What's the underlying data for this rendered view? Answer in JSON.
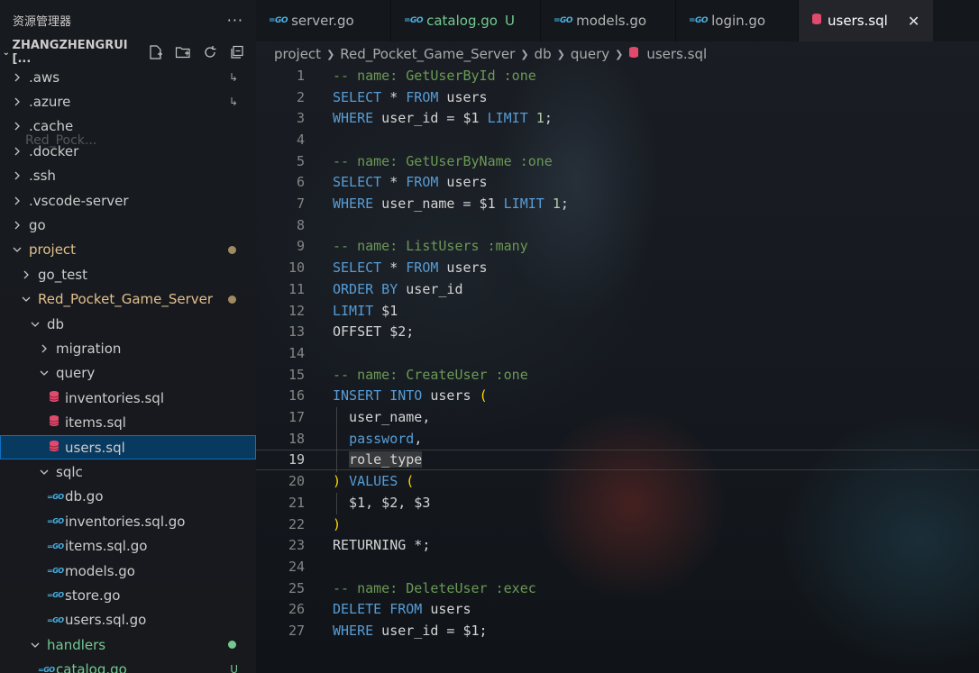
{
  "explorer": {
    "title": "资源管理器",
    "workspace": "ZHANGZHENGRUI [...",
    "items": [
      {
        "label": ".aws",
        "kind": "folder",
        "level": 0,
        "open": false,
        "marker": "↳"
      },
      {
        "label": ".azure",
        "kind": "folder",
        "level": 0,
        "open": false,
        "marker": "↳"
      },
      {
        "label": ".cache",
        "kind": "folder",
        "level": 0,
        "open": false
      },
      {
        "label": ".docker",
        "kind": "folder",
        "level": 0,
        "open": false
      },
      {
        "label": ".ssh",
        "kind": "folder",
        "level": 0,
        "open": false
      },
      {
        "label": ".vscode-server",
        "kind": "folder",
        "level": 0,
        "open": false
      },
      {
        "label": "go",
        "kind": "folder",
        "level": 0,
        "open": false
      },
      {
        "label": "project",
        "kind": "folder",
        "level": 0,
        "open": true,
        "status": "modified"
      },
      {
        "label": "go_test",
        "kind": "folder",
        "level": 1,
        "open": false
      },
      {
        "label": "Red_Pocket_Game_Server",
        "kind": "folder",
        "level": 1,
        "open": true,
        "status": "modified"
      },
      {
        "label": "db",
        "kind": "folder",
        "level": 2,
        "open": true
      },
      {
        "label": "migration",
        "kind": "folder",
        "level": 3,
        "open": false
      },
      {
        "label": "query",
        "kind": "folder",
        "level": 3,
        "open": true
      },
      {
        "label": "inventories.sql",
        "kind": "sql",
        "level": 4
      },
      {
        "label": "items.sql",
        "kind": "sql",
        "level": 4
      },
      {
        "label": "users.sql",
        "kind": "sql",
        "level": 4,
        "selected": true
      },
      {
        "label": "sqlc",
        "kind": "folder",
        "level": 3,
        "open": true
      },
      {
        "label": "db.go",
        "kind": "go",
        "level": 4
      },
      {
        "label": "inventories.sql.go",
        "kind": "go",
        "level": 4
      },
      {
        "label": "items.sql.go",
        "kind": "go",
        "level": 4
      },
      {
        "label": "models.go",
        "kind": "go",
        "level": 4
      },
      {
        "label": "store.go",
        "kind": "go",
        "level": 4
      },
      {
        "label": "users.sql.go",
        "kind": "go",
        "level": 4
      },
      {
        "label": "handlers",
        "kind": "folder",
        "level": 2,
        "open": true,
        "status": "untracked"
      },
      {
        "label": "catalog.go",
        "kind": "go",
        "level": 3,
        "badge": "U"
      }
    ]
  },
  "tabs": [
    {
      "label": "server.go",
      "icon": "go-file-icon"
    },
    {
      "label": "catalog.go",
      "icon": "go-file-icon",
      "badge": "U",
      "modified": true
    },
    {
      "label": "models.go",
      "icon": "go-file-icon"
    },
    {
      "label": "login.go",
      "icon": "go-file-icon"
    },
    {
      "label": "users.sql",
      "icon": "database-icon",
      "active": true
    }
  ],
  "breadcrumb": [
    "project",
    "Red_Pocket_Game_Server",
    "db",
    "query",
    "users.sql"
  ],
  "editor": {
    "current_line": 19,
    "lines": [
      [
        [
          "c",
          "-- name: GetUserById :one"
        ]
      ],
      [
        [
          "k",
          "SELECT"
        ],
        [
          "p",
          " * "
        ],
        [
          "k",
          "FROM"
        ],
        [
          "p",
          " users"
        ]
      ],
      [
        [
          "k",
          "WHERE"
        ],
        [
          "p",
          " user_id = $1 "
        ],
        [
          "k",
          "LIMIT"
        ],
        [
          "p",
          " "
        ],
        [
          "n",
          "1"
        ],
        [
          "p",
          ";"
        ]
      ],
      [],
      [
        [
          "c",
          "-- name: GetUserByName :one"
        ]
      ],
      [
        [
          "k",
          "SELECT"
        ],
        [
          "p",
          " * "
        ],
        [
          "k",
          "FROM"
        ],
        [
          "p",
          " users"
        ]
      ],
      [
        [
          "k",
          "WHERE"
        ],
        [
          "p",
          " user_name = $1 "
        ],
        [
          "k",
          "LIMIT"
        ],
        [
          "p",
          " "
        ],
        [
          "n",
          "1"
        ],
        [
          "p",
          ";"
        ]
      ],
      [],
      [
        [
          "c",
          "-- name: ListUsers :many"
        ]
      ],
      [
        [
          "k",
          "SELECT"
        ],
        [
          "p",
          " * "
        ],
        [
          "k",
          "FROM"
        ],
        [
          "p",
          " users"
        ]
      ],
      [
        [
          "k",
          "ORDER BY"
        ],
        [
          "p",
          " user_id"
        ]
      ],
      [
        [
          "k",
          "LIMIT"
        ],
        [
          "p",
          " $1"
        ]
      ],
      [
        [
          "p",
          "OFFSET $2;"
        ]
      ],
      [],
      [
        [
          "c",
          "-- name: CreateUser :one"
        ]
      ],
      [
        [
          "k",
          "INSERT INTO"
        ],
        [
          "p",
          " users "
        ],
        [
          "y",
          "("
        ]
      ],
      [
        [
          "p",
          "  user_name,"
        ]
      ],
      [
        [
          "p",
          "  "
        ],
        [
          "k",
          "password"
        ],
        [
          "p",
          ","
        ]
      ],
      [
        [
          "p",
          "  "
        ],
        [
          "h",
          "role_type"
        ]
      ],
      [
        [
          "y",
          ")"
        ],
        [
          "p",
          " "
        ],
        [
          "k",
          "VALUES"
        ],
        [
          "p",
          " "
        ],
        [
          "y",
          "("
        ]
      ],
      [
        [
          "p",
          "  $1, $2, $3"
        ]
      ],
      [
        [
          "y",
          ")"
        ]
      ],
      [
        [
          "p",
          "RETURNING *;"
        ]
      ],
      [],
      [
        [
          "c",
          "-- name: DeleteUser :exec"
        ]
      ],
      [
        [
          "k",
          "DELETE FROM"
        ],
        [
          "p",
          " users"
        ]
      ],
      [
        [
          "k",
          "WHERE"
        ],
        [
          "p",
          " user_id = $1;"
        ]
      ]
    ]
  },
  "colors": {
    "selected_row": "#08395f",
    "modified_dot": "#a08a62",
    "untracked_dot": "#73c991",
    "comment": "#6a9955",
    "keyword": "#569cd6"
  },
  "ghost_desktop_label": "Red_Pock..."
}
